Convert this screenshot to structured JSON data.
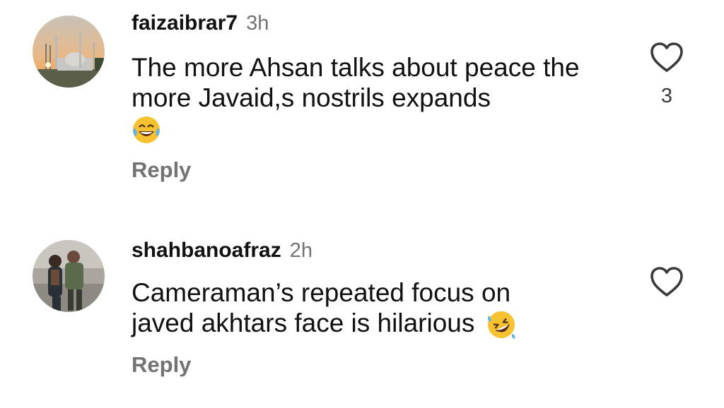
{
  "comments": [
    {
      "username": "faizaibrar7",
      "time": "3h",
      "text": "The more Ahsan talks about peace the more Javaid,s nostrils expands",
      "emoji": "face-with-tears-of-joy",
      "reply_label": "Reply",
      "like_count": "3",
      "like_icon": "heart-outline-icon"
    },
    {
      "username": "shahbanoafraz",
      "time": "2h",
      "text": "Cameraman’s repeated focus on javed akhtars face is hilarious",
      "emoji": "rolling-on-the-floor-laughing",
      "reply_label": "Reply",
      "like_count": "",
      "like_icon": "heart-outline-icon"
    }
  ],
  "colors": {
    "text": "#111111",
    "secondary": "#737373",
    "background": "#ffffff"
  }
}
